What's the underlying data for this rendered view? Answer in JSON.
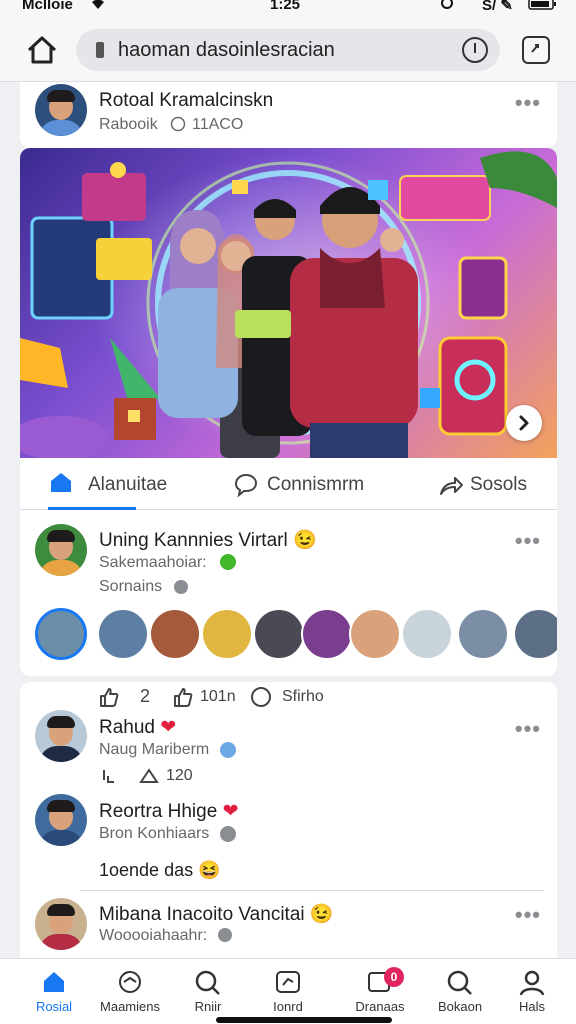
{
  "status_bar": {
    "carrier": "Mclloie",
    "time": "1:25",
    "right": "S/ ✎"
  },
  "browser": {
    "url": "haoman dasoinlesracian"
  },
  "post1": {
    "author": "Rotoal Kramalcinskn",
    "meta": "Rabooik",
    "meta_count": "11ACO"
  },
  "action_bar": {
    "like": "Alanuitae",
    "comment": "Connismrm",
    "share": "Sosols"
  },
  "post2": {
    "author": "Uning Kannnies Virtarl",
    "author_emoji": "😉",
    "line2": "Sakemaahoiar:",
    "line3": "Sornains"
  },
  "post3_header": {
    "count1": "2",
    "count2": "101n",
    "label": "Sfirho"
  },
  "comments": [
    {
      "name": "Rahud",
      "emoji": "❤",
      "sub": "Naug Mariberm",
      "likes": "120"
    },
    {
      "name": "Reortra Hhige",
      "emoji": "❤",
      "sub": "Bron Konhiaars",
      "body": "1oende das",
      "body_emoji": "😆"
    },
    {
      "name": "Mibana Inacoito Vancitai",
      "emoji": "😉",
      "sub": "Wooooiahaahr:"
    }
  ],
  "bottom_nav": [
    {
      "label": "Rosial",
      "icon": "home-icon",
      "active": true
    },
    {
      "label": "Maamiens",
      "icon": "groups-icon"
    },
    {
      "label": "Rniir",
      "icon": "search-icon"
    },
    {
      "label": "Ionrd",
      "icon": "chat-icon"
    },
    {
      "label": "Dranaas",
      "icon": "notification-icon",
      "badge": "0"
    },
    {
      "label": "Bokaon",
      "icon": "search-icon"
    },
    {
      "label": "Hals",
      "icon": "profile-icon"
    }
  ],
  "colors": {
    "accent": "#1877f2",
    "heart": "#e41e3f",
    "badge": "#e0245e"
  }
}
